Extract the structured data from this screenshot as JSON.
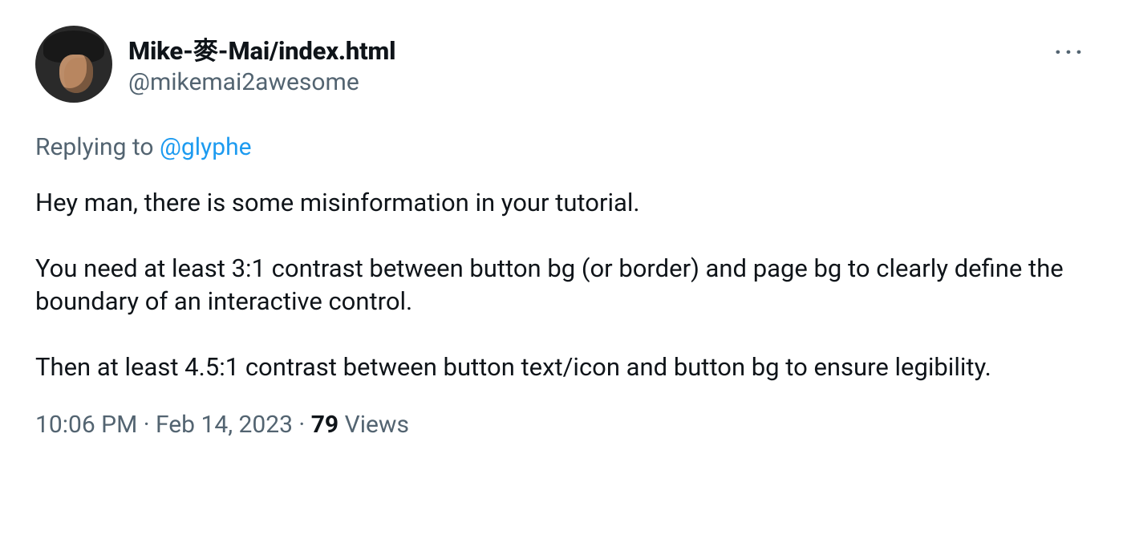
{
  "author": {
    "display_name": "Mike-麥-Mai/index.html",
    "handle": "@mikemai2awesome"
  },
  "reply": {
    "prefix": "Replying to ",
    "mention": "@glyphe"
  },
  "body": "Hey man, there is some misinformation in your tutorial.\n\nYou need at least 3:1 contrast between button bg (or border) and page bg to clearly define the boundary of an interactive control.\n\nThen at least 4.5:1 contrast between button text/icon and button bg to ensure legibility.",
  "meta": {
    "time": "10:06 PM",
    "sep1": " · ",
    "date": "Feb 14, 2023",
    "sep2": " · ",
    "views_count": "79",
    "views_label": " Views"
  },
  "icons": {
    "more": "···"
  }
}
